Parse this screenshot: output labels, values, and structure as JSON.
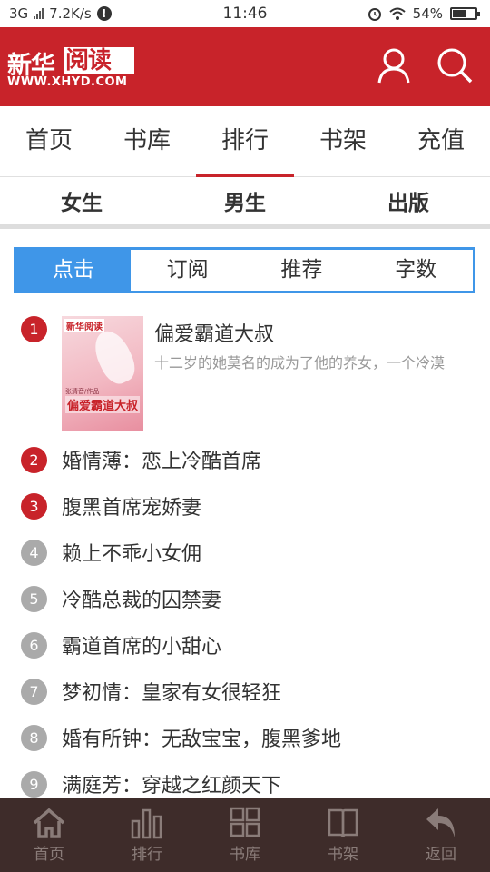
{
  "status_bar": {
    "network": "3G",
    "speed": "7.2K/s",
    "time": "11:46",
    "battery": "54%"
  },
  "header": {
    "logo_cn_1": "新华",
    "logo_cn_2": "阅读",
    "logo_url": "WWW.XHYD.COM",
    "brand_color": "#c8232a"
  },
  "main_nav": {
    "tabs": [
      "首页",
      "书库",
      "排行",
      "书架",
      "充值"
    ],
    "active": "排行"
  },
  "gender_nav": {
    "tabs": [
      "女生",
      "男生",
      "出版"
    ]
  },
  "segmented": {
    "options": [
      "点击",
      "订阅",
      "推荐",
      "字数"
    ],
    "active": "点击",
    "accent": "#3f96e8"
  },
  "rankings": [
    {
      "rank": "1",
      "title": "偏爱霸道大叔",
      "desc": "十二岁的她莫名的成为了他的养女，一个冷漠",
      "cover": {
        "logo": "新华阅读",
        "author": "张清音/作品",
        "title": "偏爱霸道大叔"
      }
    },
    {
      "rank": "2",
      "title": "婚情薄：恋上冷酷首席"
    },
    {
      "rank": "3",
      "title": "腹黑首席宠娇妻"
    },
    {
      "rank": "4",
      "title": "赖上不乖小女佣"
    },
    {
      "rank": "5",
      "title": "冷酷总裁的囚禁妻"
    },
    {
      "rank": "6",
      "title": "霸道首席的小甜心"
    },
    {
      "rank": "7",
      "title": "梦初情：皇家有女很轻狂"
    },
    {
      "rank": "8",
      "title": "婚有所钟：无敌宝宝，腹黑爹地"
    },
    {
      "rank": "9",
      "title": "满庭芳：穿越之红颜天下"
    }
  ],
  "bottom_bar": {
    "items": [
      {
        "label": "首页",
        "icon": "home-icon"
      },
      {
        "label": "排行",
        "icon": "bar-chart-icon"
      },
      {
        "label": "书库",
        "icon": "grid-icon"
      },
      {
        "label": "书架",
        "icon": "book-icon"
      },
      {
        "label": "返回",
        "icon": "back-arrow-icon"
      }
    ]
  }
}
